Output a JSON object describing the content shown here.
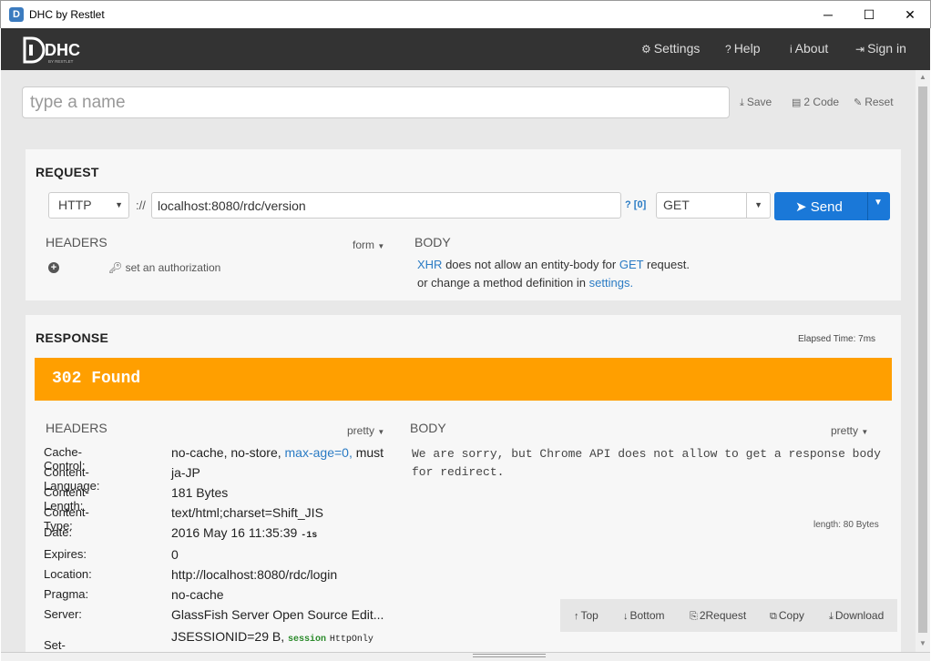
{
  "window": {
    "title": "DHC by Restlet",
    "minimize": "─",
    "maximize": "☐",
    "close": "✕"
  },
  "header": {
    "logo_text": "DHC",
    "logo_sub": "BY RESTLET",
    "nav": [
      {
        "icon": "⚙",
        "label": "Settings"
      },
      {
        "icon": "?",
        "label": "Help"
      },
      {
        "icon": "i",
        "label": "About"
      },
      {
        "icon": "⇥",
        "label": "Sign in"
      }
    ]
  },
  "name_field": {
    "placeholder": "type a name",
    "value": ""
  },
  "toolbar": {
    "save": {
      "icon": "⤓",
      "label": "Save"
    },
    "code": {
      "icon": "▤",
      "label": "2 Code"
    },
    "reset": {
      "icon": "✎",
      "label": "Reset"
    }
  },
  "request": {
    "title": "REQUEST",
    "scheme": "HTTP",
    "sep": "://",
    "url": "localhost:8080/rdc/version",
    "query_hint": "?",
    "query_count": "[0]",
    "method": "GET",
    "send_label": "Send",
    "headers_title": "HEADERS",
    "headers_mode": "form",
    "add_icon": "+",
    "auth_label": "set an authorization",
    "body_title": "BODY",
    "body_msg": {
      "xhr": "XHR",
      "part1": "does not allow an entity-body for",
      "method": "GET",
      "part2": "request.",
      "line2": "or change a method definition in",
      "settings": "settings."
    }
  },
  "response": {
    "title": "RESPONSE",
    "elapsed": "Elapsed Time: 7ms",
    "status": "302 Found",
    "headers_title": "HEADERS",
    "headers_mode": "pretty",
    "body_title": "BODY",
    "body_mode": "pretty",
    "body_text": "We are sorry, but Chrome API does not allow to get a response body for redirect.",
    "length": "length: 80 Bytes",
    "headers": [
      {
        "key": "Cache-Control:",
        "value": "no-cache, no-store,",
        "link": "max-age=0,",
        "tail": "must"
      },
      {
        "key": "Content-Language:",
        "value": "ja-JP"
      },
      {
        "key": "Content-Length:",
        "value": "181 Bytes"
      },
      {
        "key": "Content-Type:",
        "value": "text/html;charset=Shift_JIS"
      },
      {
        "key": "Date:",
        "value": "2016 May 16 11:35:39",
        "extra": "-1s"
      },
      {
        "key": "Expires:",
        "value": "0"
      },
      {
        "key": "Location:",
        "link": "http://localhost:8080/rdc/login"
      },
      {
        "key": "Pragma:",
        "value": "no-cache"
      },
      {
        "key": "Server:",
        "value": "GlassFish Server Open Source Edit..."
      },
      {
        "key": "Set-Cookie:",
        "value": "JSESSIONID=29 B,",
        "badge1": "session",
        "badge2": "HttpOnly"
      }
    ],
    "footer": {
      "top": {
        "icon": "↑",
        "label": "Top"
      },
      "bottom": {
        "icon": "↓",
        "label": "Bottom"
      },
      "to_request": {
        "icon": "⎘",
        "label": "2Request"
      },
      "copy": {
        "icon": "⧉",
        "label": "Copy"
      },
      "download": {
        "icon": "⤓",
        "label": "Download"
      }
    }
  }
}
